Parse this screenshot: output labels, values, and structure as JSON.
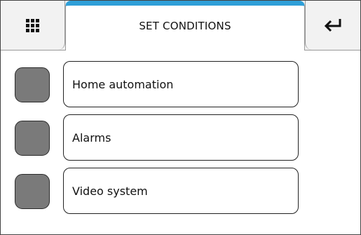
{
  "header": {
    "title": "SET CONDITIONS",
    "menu_icon": "grid-menu-icon",
    "back_icon": "return-arrow-icon",
    "accent_color": "#2f9fd8"
  },
  "conditions": [
    {
      "label": "Home automation",
      "indicator_color": "#7a7a7a"
    },
    {
      "label": "Alarms",
      "indicator_color": "#7a7a7a"
    },
    {
      "label": "Video system",
      "indicator_color": "#7a7a7a"
    }
  ]
}
